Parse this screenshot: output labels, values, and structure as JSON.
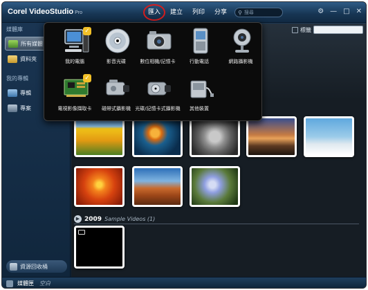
{
  "app": {
    "title": "Corel VideoStudio",
    "subtitle": "Pro"
  },
  "menu": {
    "items": [
      "匯入",
      "建立",
      "列印",
      "分享"
    ],
    "active_index": 0,
    "active_highlight_color": "#d51d1d"
  },
  "search": {
    "placeholder": "搜尋",
    "icon": "search-icon"
  },
  "window_controls": [
    "settings-icon",
    "minimize-icon",
    "restore-icon",
    "close-icon"
  ],
  "sidebar": {
    "library_heading": "媒體庫",
    "library_items": [
      {
        "label": "所有媒體",
        "icon": "all-media-icon",
        "selected": true
      },
      {
        "label": "資料夾",
        "icon": "folder-icon",
        "selected": false
      }
    ],
    "my_projects_heading": "我的專輯",
    "project_items": [
      {
        "label": "專輯",
        "icon": "album-icon"
      },
      {
        "label": "專案",
        "icon": "project-icon"
      }
    ],
    "recycle_label": "資源回收桶"
  },
  "toolbar": {
    "tag_label": "標籤"
  },
  "import_menu": {
    "items": [
      {
        "label": "我的電腦",
        "icon": "computer-icon",
        "checked": true
      },
      {
        "label": "影音光碟",
        "icon": "disc-icon",
        "checked": false
      },
      {
        "label": "數位相機/記憶卡",
        "icon": "digital-camera-icon",
        "checked": false
      },
      {
        "label": "行動電話",
        "icon": "mobile-phone-icon",
        "checked": false
      },
      {
        "label": "網路攝影機",
        "icon": "webcam-icon",
        "checked": false
      },
      {
        "label": "電視影像擷取卡",
        "icon": "tv-capture-card-icon",
        "checked": true
      },
      {
        "label": "磁帶式攝影機",
        "icon": "tape-camcorder-icon",
        "checked": false
      },
      {
        "label": "光碟/記憶卡式攝影機",
        "icon": "disc-camcorder-icon",
        "checked": false
      },
      {
        "label": "其他裝置",
        "icon": "other-device-icon",
        "checked": false
      }
    ]
  },
  "thumbnails": [
    {
      "subject": "tulips"
    },
    {
      "subject": "jellyfish"
    },
    {
      "subject": "koala"
    },
    {
      "subject": "lighthouse"
    },
    {
      "subject": "penguins"
    },
    {
      "subject": "chrysanthemum"
    },
    {
      "subject": "desert"
    },
    {
      "subject": "hydrangeas"
    },
    {
      "subject": "video"
    }
  ],
  "section": {
    "year": "2009",
    "name": "Sample Videos (1)"
  },
  "statusbar": {
    "title": "媒體匣",
    "text": "空白"
  }
}
